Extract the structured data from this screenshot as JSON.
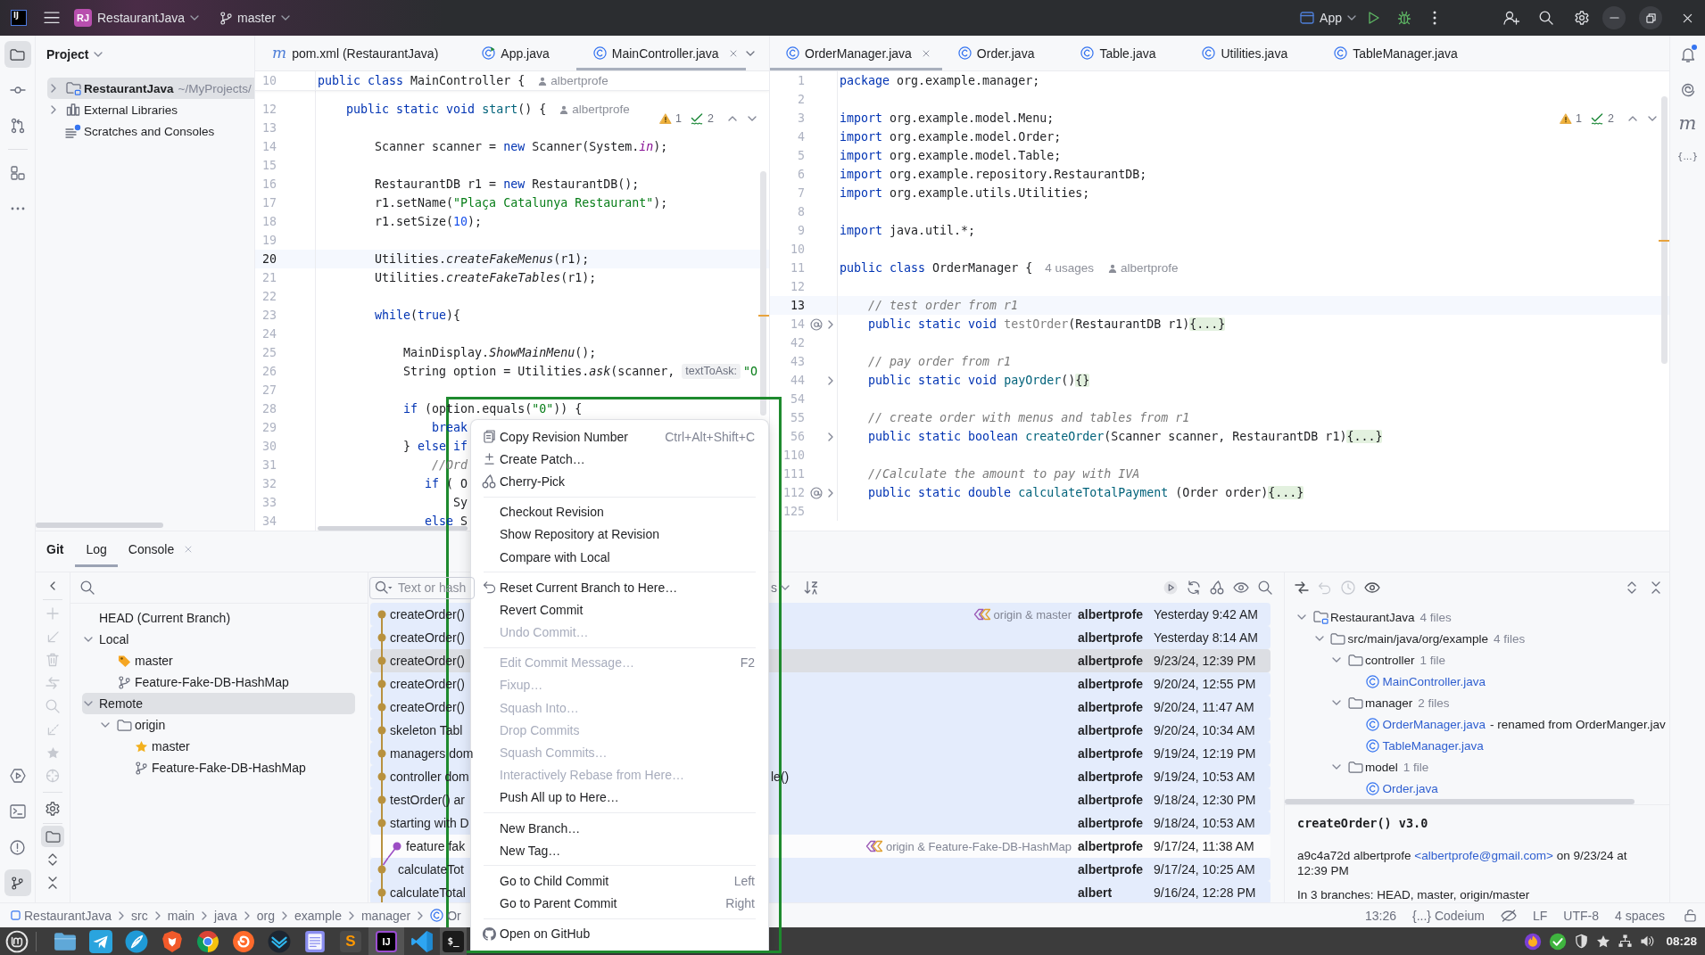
{
  "title_bar": {
    "logo": "IJ",
    "project_badge": "RJ",
    "project": "RestaurantJava",
    "branch": "master",
    "run_config": "App"
  },
  "left_strip": {
    "top": [
      {
        "kind": "project",
        "selected": true
      },
      {
        "kind": "commit",
        "selected": false
      },
      {
        "kind": "pull_requests",
        "selected": false
      },
      {
        "kind": "structure",
        "selected": false
      },
      {
        "kind": "more",
        "selected": false
      }
    ],
    "bottom": [
      {
        "kind": "services",
        "selected": false
      },
      {
        "kind": "terminal",
        "selected": false
      },
      {
        "kind": "problems",
        "selected": false
      },
      {
        "kind": "git",
        "selected": true
      }
    ]
  },
  "right_strip": {
    "tools": [
      {
        "kind": "notifications",
        "unread": true
      },
      {
        "kind": "assistant"
      },
      {
        "kind": "glyph",
        "label": "m"
      },
      {
        "kind": "label",
        "label": "{...}"
      }
    ]
  },
  "project_panel": {
    "title": "Project",
    "items": [
      {
        "name": "RestaurantJava",
        "path": "~/MyProjects/",
        "kind": "module",
        "expanded": false,
        "selected": true
      },
      {
        "name": "External Libraries",
        "kind": "libraries",
        "expanded": false,
        "selected": false
      },
      {
        "name": "Scratches and Consoles",
        "kind": "scratches",
        "selected": false
      }
    ]
  },
  "left_editor": {
    "tabs": [
      {
        "label": "pom.xml (RestaurantJava)",
        "kind": "maven",
        "icon_label": "m",
        "selected": false
      },
      {
        "label": "App.java",
        "kind": "main_class",
        "selected": false
      },
      {
        "label": "MainController.java",
        "kind": "class",
        "selected": true
      }
    ],
    "inspections": {
      "warnings": "1",
      "passed": "2"
    },
    "sticky": {
      "number": "10",
      "code": [
        {
          "kind": "kw",
          "text": "public class "
        },
        {
          "kind": "plain",
          "text": "MainController {"
        }
      ],
      "author": "albertprofe"
    },
    "lines": [
      {
        "number": "12",
        "current": false,
        "code": [
          {
            "kind": "kw",
            "text": "    public static void "
          },
          {
            "kind": "decl",
            "text": "start"
          },
          {
            "kind": "plain",
            "text": "() {"
          }
        ],
        "author": "albertprofe"
      },
      {
        "number": "13",
        "current": false
      },
      {
        "number": "14",
        "current": false,
        "code": [
          {
            "kind": "plain",
            "text": "        Scanner scanner = "
          },
          {
            "kind": "kw",
            "text": "new"
          },
          {
            "kind": "plain",
            "text": " Scanner(System."
          },
          {
            "kind": "field",
            "text": "in"
          },
          {
            "kind": "plain",
            "text": ");"
          }
        ]
      },
      {
        "number": "15",
        "current": false
      },
      {
        "number": "16",
        "current": false,
        "code": [
          {
            "kind": "plain",
            "text": "        RestaurantDB r1 = "
          },
          {
            "kind": "kw",
            "text": "new"
          },
          {
            "kind": "plain",
            "text": " RestaurantDB();"
          }
        ]
      },
      {
        "number": "17",
        "current": false,
        "code": [
          {
            "kind": "plain",
            "text": "        r1.setName("
          },
          {
            "kind": "str",
            "text": "\"Plaça Catalunya Restaurant\""
          },
          {
            "kind": "plain",
            "text": ");"
          }
        ]
      },
      {
        "number": "18",
        "current": false,
        "code": [
          {
            "kind": "plain",
            "text": "        r1.setSize("
          },
          {
            "kind": "num",
            "text": "10"
          },
          {
            "kind": "plain",
            "text": ");"
          }
        ]
      },
      {
        "number": "19",
        "current": false
      },
      {
        "number": "20",
        "current": true,
        "code": [
          {
            "kind": "plain",
            "text": "        Utilities."
          },
          {
            "kind": "ital",
            "text": "createFakeMenus"
          },
          {
            "kind": "plain",
            "text": "(r1);"
          }
        ]
      },
      {
        "number": "21",
        "current": false,
        "code": [
          {
            "kind": "plain",
            "text": "        Utilities."
          },
          {
            "kind": "ital",
            "text": "createFakeTables"
          },
          {
            "kind": "plain",
            "text": "(r1);"
          }
        ]
      },
      {
        "number": "22",
        "current": false
      },
      {
        "number": "23",
        "current": false,
        "code": [
          {
            "kind": "kw",
            "text": "        while"
          },
          {
            "kind": "plain",
            "text": "("
          },
          {
            "kind": "kw",
            "text": "true"
          },
          {
            "kind": "plain",
            "text": "){"
          }
        ]
      },
      {
        "number": "24",
        "current": false
      },
      {
        "number": "25",
        "current": false,
        "code": [
          {
            "kind": "plain",
            "text": "            MainDisplay."
          },
          {
            "kind": "ital",
            "text": "ShowMainMenu"
          },
          {
            "kind": "plain",
            "text": "();"
          }
        ]
      },
      {
        "number": "26",
        "current": false,
        "code": [
          {
            "kind": "plain",
            "text": "            String option = Utilities."
          },
          {
            "kind": "ital",
            "text": "ask"
          },
          {
            "kind": "plain",
            "text": "(scanner,"
          }
        ],
        "param_hint": "textToAsk:",
        "code_after": [
          {
            "kind": "str",
            "text": "\"O"
          }
        ]
      },
      {
        "number": "27",
        "current": false
      },
      {
        "number": "28",
        "current": false,
        "code": [
          {
            "kind": "kw",
            "text": "            if"
          },
          {
            "kind": "plain",
            "text": " (option.equals("
          },
          {
            "kind": "str",
            "text": "\"0\""
          },
          {
            "kind": "plain",
            "text": ")) {"
          }
        ]
      },
      {
        "number": "29",
        "current": false,
        "code": [
          {
            "kind": "kw",
            "text": "                break"
          }
        ]
      },
      {
        "number": "30",
        "current": false,
        "code": [
          {
            "kind": "plain",
            "text": "            } "
          },
          {
            "kind": "kw",
            "text": "else if"
          }
        ]
      },
      {
        "number": "31",
        "current": false,
        "code": [
          {
            "kind": "cmt",
            "text": "                //Ord"
          }
        ]
      },
      {
        "number": "32",
        "current": false,
        "code": [
          {
            "kind": "kw",
            "text": "               if"
          },
          {
            "kind": "plain",
            "text": " ( O"
          }
        ]
      },
      {
        "number": "33",
        "current": false,
        "code": [
          {
            "kind": "plain",
            "text": "                   Sy"
          }
        ]
      },
      {
        "number": "34",
        "current": false,
        "code": [
          {
            "kind": "kw",
            "text": "               else"
          },
          {
            "kind": "plain",
            "text": " S"
          }
        ]
      }
    ]
  },
  "right_editor": {
    "tabs": [
      {
        "label": "OrderManager.java",
        "kind": "class",
        "selected": true
      },
      {
        "label": "Order.java",
        "kind": "class",
        "selected": false
      },
      {
        "label": "Table.java",
        "kind": "class",
        "selected": false
      },
      {
        "label": "Utilities.java",
        "kind": "class",
        "selected": false
      },
      {
        "label": "TableManager.java",
        "kind": "class",
        "selected": false
      }
    ],
    "inspections": {
      "warnings": "1",
      "passed": "2"
    },
    "lines": [
      {
        "number": "1",
        "current": false,
        "overrides": false,
        "folded": false,
        "code": [
          {
            "kind": "kw",
            "text": "package "
          },
          {
            "kind": "plain",
            "text": "org.example.manager;"
          }
        ]
      },
      {
        "number": "2",
        "current": false,
        "overrides": false,
        "folded": false
      },
      {
        "number": "3",
        "current": false,
        "overrides": false,
        "folded": false,
        "code": [
          {
            "kind": "kw",
            "text": "import "
          },
          {
            "kind": "plain",
            "text": "org.example.model.Menu;"
          }
        ]
      },
      {
        "number": "4",
        "current": false,
        "overrides": false,
        "folded": false,
        "code": [
          {
            "kind": "kw",
            "text": "import "
          },
          {
            "kind": "plain",
            "text": "org.example.model.Order;"
          }
        ]
      },
      {
        "number": "5",
        "current": false,
        "overrides": false,
        "folded": false,
        "code": [
          {
            "kind": "kw",
            "text": "import "
          },
          {
            "kind": "plain",
            "text": "org.example.model.Table;"
          }
        ]
      },
      {
        "number": "6",
        "current": false,
        "overrides": false,
        "folded": false,
        "code": [
          {
            "kind": "kw",
            "text": "import "
          },
          {
            "kind": "plain",
            "text": "org.example.repository.RestaurantDB;"
          }
        ]
      },
      {
        "number": "7",
        "current": false,
        "overrides": false,
        "folded": false,
        "code": [
          {
            "kind": "kw",
            "text": "import "
          },
          {
            "kind": "plain",
            "text": "org.example.utils.Utilities;"
          }
        ]
      },
      {
        "number": "8",
        "current": false,
        "overrides": false,
        "folded": false
      },
      {
        "number": "9",
        "current": false,
        "overrides": false,
        "folded": false,
        "code": [
          {
            "kind": "kw",
            "text": "import "
          },
          {
            "kind": "plain",
            "text": "java.util.*;"
          }
        ]
      },
      {
        "number": "10",
        "current": false,
        "overrides": false,
        "folded": false
      },
      {
        "number": "11",
        "current": false,
        "overrides": false,
        "folded": false,
        "code": [
          {
            "kind": "kw",
            "text": "public class "
          },
          {
            "kind": "plain",
            "text": "OrderManager {"
          }
        ],
        "usages": "4 usages",
        "author": "albertprofe"
      },
      {
        "number": "12",
        "current": false,
        "overrides": false,
        "folded": false
      },
      {
        "number": "13",
        "current": true,
        "overrides": false,
        "folded": false,
        "code": [
          {
            "kind": "cmt",
            "text": "    // test order from r1"
          }
        ]
      },
      {
        "number": "14",
        "current": false,
        "overrides": true,
        "folded": true,
        "code": [
          {
            "kind": "kw",
            "text": "    public static void "
          },
          {
            "kind": "unused",
            "text": "testOrder"
          },
          {
            "kind": "plain",
            "text": "(RestaurantDB r1)"
          }
        ],
        "fold": "{...}"
      },
      {
        "number": "42",
        "current": false,
        "overrides": false,
        "folded": false
      },
      {
        "number": "43",
        "current": false,
        "overrides": false,
        "folded": false,
        "code": [
          {
            "kind": "cmt",
            "text": "    // pay order from r1"
          }
        ]
      },
      {
        "number": "44",
        "current": false,
        "overrides": false,
        "folded": true,
        "code": [
          {
            "kind": "kw",
            "text": "    public static void "
          },
          {
            "kind": "decl",
            "text": "payOrder"
          },
          {
            "kind": "plain",
            "text": "()"
          }
        ],
        "fold": "{}"
      },
      {
        "number": "54",
        "current": false,
        "overrides": false,
        "folded": false
      },
      {
        "number": "55",
        "current": false,
        "overrides": false,
        "folded": false,
        "code": [
          {
            "kind": "cmt",
            "text": "    // create order with menus and tables from r1"
          }
        ]
      },
      {
        "number": "56",
        "current": false,
        "overrides": false,
        "folded": true,
        "code": [
          {
            "kind": "kw",
            "text": "    public static boolean "
          },
          {
            "kind": "decl",
            "text": "createOrder"
          },
          {
            "kind": "plain",
            "text": "(Scanner scanner, RestaurantDB r1)"
          }
        ],
        "fold": "{...}"
      },
      {
        "number": "110",
        "current": false,
        "overrides": false,
        "folded": false
      },
      {
        "number": "111",
        "current": false,
        "overrides": false,
        "folded": false,
        "code": [
          {
            "kind": "cmt",
            "text": "    //Calculate the amount to pay with IVA"
          }
        ]
      },
      {
        "number": "112",
        "current": false,
        "overrides": true,
        "folded": true,
        "code": [
          {
            "kind": "kw",
            "text": "    public static double "
          },
          {
            "kind": "decl",
            "text": "calculateTotalPayment"
          },
          {
            "kind": "plain",
            "text": " (Order order)"
          }
        ],
        "fold": "{...}"
      },
      {
        "number": "125",
        "current": false,
        "overrides": false,
        "folded": false
      }
    ]
  },
  "bottom_panel": {
    "title": "Git",
    "tabs": [
      {
        "label": "Log",
        "selected": true,
        "closable": false
      },
      {
        "label": "Console",
        "selected": false,
        "closable": true
      }
    ],
    "branch_tools": [
      {
        "kind": "hide",
        "disabled": false,
        "selected": false
      },
      {
        "kind": "new_branch",
        "disabled": true,
        "selected": false
      },
      {
        "kind": "update",
        "disabled": true,
        "selected": false
      },
      {
        "kind": "delete",
        "disabled": true,
        "selected": false
      },
      {
        "kind": "compare",
        "disabled": true,
        "selected": false
      },
      {
        "kind": "search",
        "disabled": true,
        "selected": false
      },
      {
        "kind": "fetch",
        "disabled": true,
        "selected": false
      },
      {
        "kind": "favorite",
        "disabled": true,
        "selected": false
      },
      {
        "kind": "navigate",
        "disabled": true,
        "selected": false
      },
      {
        "kind": "settings",
        "disabled": false,
        "selected": false
      },
      {
        "kind": "group",
        "disabled": false,
        "selected": true
      },
      {
        "kind": "expand",
        "disabled": false,
        "selected": false
      },
      {
        "kind": "collapse",
        "disabled": false,
        "selected": false
      }
    ],
    "branches": {
      "items": [
        {
          "label": "HEAD (Current Branch)",
          "selected": false
        },
        {
          "label": "Local",
          "expanded": true,
          "selected": false,
          "children": [
            {
              "label": "master",
              "kind": "current",
              "selected": false
            },
            {
              "label": "Feature-Fake-DB-HashMap",
              "kind": "branch",
              "selected": false
            }
          ]
        },
        {
          "label": "Remote",
          "expanded": true,
          "selected": true,
          "children": [
            {
              "label": "origin",
              "kind": "folder",
              "expanded": true,
              "selected": false,
              "children": [
                {
                  "label": "master",
                  "kind": "favorite",
                  "selected": false
                },
                {
                  "label": "Feature-Fake-DB-HashMap",
                  "kind": "branch",
                  "selected": false
                }
              ]
            }
          ]
        }
      ]
    },
    "log": {
      "filter_placeholder": "Text or hash",
      "filter_tail": "s",
      "commits": [
        {
          "subject": "createOrder()",
          "refs": "origin & master",
          "author": "albertprofe",
          "date": "Yesterday 9:42 AM",
          "kind": "main",
          "color": "#b8913e",
          "in_current_branch": true,
          "selected": false
        },
        {
          "subject": "createOrder()",
          "author": "albertprofe",
          "date": "Yesterday 8:14 AM",
          "kind": "main",
          "color": "#b8913e",
          "in_current_branch": true,
          "selected": false
        },
        {
          "subject": "createOrder()",
          "author": "albertprofe",
          "date": "9/23/24, 12:39 PM",
          "kind": "main",
          "color": "#b8913e",
          "in_current_branch": true,
          "selected": true
        },
        {
          "subject": "createOrder()",
          "author": "albertprofe",
          "date": "9/20/24, 12:55 PM",
          "kind": "main",
          "color": "#b8913e",
          "in_current_branch": true,
          "selected": false
        },
        {
          "subject": "createOrder()",
          "author": "albertprofe",
          "date": "9/20/24, 11:47 AM",
          "kind": "main",
          "color": "#b8913e",
          "in_current_branch": true,
          "selected": false
        },
        {
          "subject": "skeleton Tabl",
          "author": "albertprofe",
          "date": "9/20/24, 10:34 AM",
          "kind": "main",
          "color": "#b8913e",
          "in_current_branch": true,
          "selected": false
        },
        {
          "subject": "managers dom",
          "author": "albertprofe",
          "date": "9/19/24, 12:19 PM",
          "kind": "main",
          "color": "#b8913e",
          "in_current_branch": true,
          "selected": false
        },
        {
          "subject": "controller dom",
          "subject_tail": "le()",
          "author": "albertprofe",
          "date": "9/19/24, 10:53 AM",
          "kind": "main",
          "color": "#b8913e",
          "in_current_branch": true,
          "selected": false
        },
        {
          "subject": "testOrder() ar",
          "author": "albertprofe",
          "date": "9/18/24, 12:30 PM",
          "kind": "main",
          "color": "#b8913e",
          "in_current_branch": true,
          "selected": false
        },
        {
          "subject": "starting with D",
          "author": "albertprofe",
          "date": "9/18/24, 10:53 AM",
          "kind": "main",
          "color": "#b8913e",
          "in_current_branch": true,
          "selected": false
        },
        {
          "subject": "feature fak",
          "refs": "origin & Feature-Fake-DB-HashMap",
          "author": "albertprofe",
          "date": "9/17/24, 11:38 AM",
          "kind": "side",
          "color": "#9c4dc4",
          "in_current_branch": false,
          "selected": false
        },
        {
          "subject": "calculateTot",
          "author": "albertprofe",
          "date": "9/17/24, 10:25 AM",
          "kind": "join",
          "color": "#b8913e",
          "in_current_branch": true,
          "selected": false
        },
        {
          "subject": "calculateTotal",
          "author": "albert",
          "date": "9/16/24, 12:28 PM",
          "kind": "main",
          "color": "#b8913e",
          "in_current_branch": true,
          "selected": false
        }
      ]
    },
    "changes": {
      "tools": [
        {
          "kind": "diff",
          "disabled": false
        },
        {
          "kind": "revert",
          "disabled": true
        },
        {
          "kind": "history",
          "disabled": true
        },
        {
          "kind": "preview",
          "disabled": false
        }
      ],
      "tree": [
        {
          "label": "RestaurantJava",
          "count": "4 files",
          "kind": "module",
          "expanded": true,
          "children": [
            {
              "label": "src/main/java/org/example",
              "count": "4 files",
              "kind": "folder",
              "expanded": true,
              "children": [
                {
                  "label": "controller",
                  "count": "1 file",
                  "kind": "folder",
                  "expanded": true,
                  "children": [
                    {
                      "label": "MainController.java",
                      "kind": "class"
                    }
                  ]
                },
                {
                  "label": "manager",
                  "count": "2 files",
                  "kind": "folder",
                  "expanded": true,
                  "children": [
                    {
                      "label": "OrderManager.java",
                      "kind": "class",
                      "note": "- renamed from OrderManger.jav"
                    },
                    {
                      "label": "TableManager.java",
                      "kind": "class"
                    }
                  ]
                },
                {
                  "label": "model",
                  "count": "1 file",
                  "kind": "folder",
                  "expanded": true,
                  "children": [
                    {
                      "label": "Order.java",
                      "kind": "class"
                    }
                  ]
                }
              ]
            }
          ]
        }
      ]
    },
    "details": {
      "subject": "createOrder() v3.0",
      "info_before": "a9c4a72d albertprofe",
      "email": "<albertprofe@gmail.com>",
      "info_after": "on 9/23/24 at 12:39 PM",
      "branches": "In 3 branches: HEAD, master, origin/master"
    }
  },
  "context_menu": {
    "groups": [
      {
        "items": [
          {
            "label": "Copy Revision Number",
            "shortcut": "Ctrl+Alt+Shift+C",
            "kind": "copy",
            "disabled": false
          },
          {
            "label": "Create Patch…",
            "kind": "patch",
            "disabled": false
          },
          {
            "label": "Cherry-Pick",
            "kind": "cherry",
            "disabled": false
          }
        ]
      },
      {
        "items": [
          {
            "label": "Checkout Revision",
            "kind": "plain",
            "disabled": false
          },
          {
            "label": "Show Repository at Revision",
            "kind": "plain",
            "disabled": false
          },
          {
            "label": "Compare with Local",
            "kind": "plain",
            "disabled": false
          }
        ]
      },
      {
        "items": [
          {
            "label": "Reset Current Branch to Here…",
            "kind": "reset",
            "disabled": false
          },
          {
            "label": "Revert Commit",
            "kind": "plain",
            "disabled": false
          },
          {
            "label": "Undo Commit…",
            "kind": "plain",
            "disabled": true
          }
        ]
      },
      {
        "items": [
          {
            "label": "Edit Commit Message…",
            "shortcut": "F2",
            "kind": "plain",
            "disabled": true
          },
          {
            "label": "Fixup…",
            "kind": "plain",
            "disabled": true
          },
          {
            "label": "Squash Into…",
            "kind": "plain",
            "disabled": true
          },
          {
            "label": "Drop Commits",
            "kind": "plain",
            "disabled": true
          },
          {
            "label": "Squash Commits…",
            "kind": "plain",
            "disabled": true
          },
          {
            "label": "Interactively Rebase from Here…",
            "kind": "plain",
            "disabled": true
          },
          {
            "label": "Push All up to Here…",
            "kind": "plain",
            "disabled": false
          }
        ]
      },
      {
        "items": [
          {
            "label": "New Branch…",
            "kind": "plain",
            "disabled": false
          },
          {
            "label": "New Tag…",
            "kind": "plain",
            "disabled": false
          }
        ]
      },
      {
        "items": [
          {
            "label": "Go to Child Commit",
            "shortcut": "Left",
            "kind": "plain",
            "disabled": false
          },
          {
            "label": "Go to Parent Commit",
            "shortcut": "Right",
            "kind": "plain",
            "disabled": false
          }
        ]
      },
      {
        "items": [
          {
            "label": "Open on GitHub",
            "kind": "github",
            "disabled": false
          }
        ]
      }
    ]
  },
  "status_bar": {
    "breadcrumbs": [
      {
        "label": "RestaurantJava",
        "kind": "module"
      },
      {
        "label": "src",
        "kind": "dir"
      },
      {
        "label": "main",
        "kind": "dir"
      },
      {
        "label": "java",
        "kind": "dir"
      },
      {
        "label": "org",
        "kind": "dir"
      },
      {
        "label": "example",
        "kind": "dir"
      },
      {
        "label": "manager",
        "kind": "dir"
      },
      {
        "label": "Or",
        "kind": "class"
      }
    ],
    "caret": "13:26",
    "plugin": "{...} Codeium",
    "line_separator": "LF",
    "encoding": "UTF-8",
    "indent": "4 spaces"
  },
  "taskbar": {
    "apps": [
      {
        "kind": "files",
        "running": false
      },
      {
        "kind": "telegram",
        "running": false
      },
      {
        "kind": "feather",
        "running": false
      },
      {
        "kind": "brave",
        "running": false
      },
      {
        "kind": "chrome",
        "running": false
      },
      {
        "kind": "fox",
        "running": false
      },
      {
        "kind": "mail",
        "running": false
      },
      {
        "kind": "notes",
        "running": false
      },
      {
        "kind": "sublime",
        "label": "S",
        "running": false
      },
      {
        "kind": "intellij",
        "label": "IJ",
        "running": true
      },
      {
        "kind": "vscode",
        "running": false
      },
      {
        "kind": "terminal",
        "label": "$_",
        "running": true
      }
    ],
    "clock": "08:28"
  }
}
